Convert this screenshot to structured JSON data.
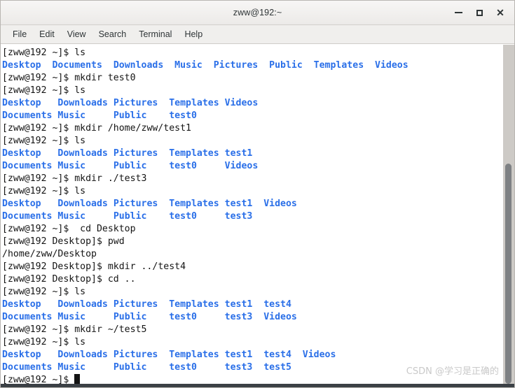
{
  "window": {
    "title": "zww@192:~",
    "buttons": {
      "minimize": "minimize",
      "maximize": "maximize",
      "close": "✕"
    }
  },
  "menubar": {
    "items": [
      {
        "label": "File"
      },
      {
        "label": "Edit"
      },
      {
        "label": "View"
      },
      {
        "label": "Search"
      },
      {
        "label": "Terminal"
      },
      {
        "label": "Help"
      }
    ]
  },
  "terminal": {
    "prompt_home": "[zww@192 ~]$ ",
    "prompt_desktop": "[zww@192 Desktop]$ ",
    "cursor": "block",
    "lines": [
      {
        "type": "command",
        "prompt": "[zww@192 ~]$ ",
        "command": "ls"
      },
      {
        "type": "listing",
        "cells": [
          "Desktop",
          "Documents",
          "Downloads",
          "Music",
          "Pictures",
          "Public",
          "Templates",
          "Videos"
        ],
        "layout": "inline"
      },
      {
        "type": "command",
        "prompt": "[zww@192 ~]$ ",
        "command": "mkdir test0"
      },
      {
        "type": "command",
        "prompt": "[zww@192 ~]$ ",
        "command": "ls"
      },
      {
        "type": "listing",
        "cells": [
          "Desktop",
          "Downloads",
          "Pictures",
          "Templates",
          "Videos"
        ],
        "layout": "columns"
      },
      {
        "type": "listing",
        "cells": [
          "Documents",
          "Music",
          "Public",
          "test0"
        ],
        "layout": "columns"
      },
      {
        "type": "command",
        "prompt": "[zww@192 ~]$ ",
        "command": "mkdir /home/zww/test1"
      },
      {
        "type": "command",
        "prompt": "[zww@192 ~]$ ",
        "command": "ls"
      },
      {
        "type": "listing",
        "cells": [
          "Desktop",
          "Downloads",
          "Pictures",
          "Templates",
          "test1"
        ],
        "layout": "columns"
      },
      {
        "type": "listing",
        "cells": [
          "Documents",
          "Music",
          "Public",
          "test0",
          "Videos"
        ],
        "layout": "columns"
      },
      {
        "type": "command",
        "prompt": "[zww@192 ~]$ ",
        "command": "mkdir ./test3"
      },
      {
        "type": "command",
        "prompt": "[zww@192 ~]$ ",
        "command": "ls"
      },
      {
        "type": "listing",
        "cells": [
          "Desktop",
          "Downloads",
          "Pictures",
          "Templates",
          "test1",
          "Videos"
        ],
        "layout": "columns6"
      },
      {
        "type": "listing",
        "cells": [
          "Documents",
          "Music",
          "Public",
          "test0",
          "test3"
        ],
        "layout": "columns6"
      },
      {
        "type": "command",
        "prompt": "[zww@192 ~]$ ",
        "command": " cd Desktop"
      },
      {
        "type": "command",
        "prompt": "[zww@192 Desktop]$ ",
        "command": "pwd"
      },
      {
        "type": "output",
        "text": "/home/zww/Desktop"
      },
      {
        "type": "command",
        "prompt": "[zww@192 Desktop]$ ",
        "command": "mkdir ../test4"
      },
      {
        "type": "command",
        "prompt": "[zww@192 Desktop]$ ",
        "command": "cd .."
      },
      {
        "type": "command",
        "prompt": "[zww@192 ~]$ ",
        "command": "ls"
      },
      {
        "type": "listing",
        "cells": [
          "Desktop",
          "Downloads",
          "Pictures",
          "Templates",
          "test1",
          "test4"
        ],
        "layout": "columns6"
      },
      {
        "type": "listing",
        "cells": [
          "Documents",
          "Music",
          "Public",
          "test0",
          "test3",
          "Videos"
        ],
        "layout": "columns6"
      },
      {
        "type": "command",
        "prompt": "[zww@192 ~]$ ",
        "command": "mkdir ~/test5"
      },
      {
        "type": "command",
        "prompt": "[zww@192 ~]$ ",
        "command": "ls"
      },
      {
        "type": "listing",
        "cells": [
          "Desktop",
          "Downloads",
          "Pictures",
          "Templates",
          "test1",
          "test4",
          "Videos"
        ],
        "layout": "columns7"
      },
      {
        "type": "listing",
        "cells": [
          "Documents",
          "Music",
          "Public",
          "test0",
          "test3",
          "test5"
        ],
        "layout": "columns7"
      },
      {
        "type": "prompt_cursor",
        "prompt": "[zww@192 ~]$ "
      }
    ]
  },
  "scrollbar": {
    "thumb_top_percent": 35,
    "thumb_height_percent": 65
  },
  "watermark": {
    "text": "CSDN @学习是正确的"
  },
  "colors": {
    "directory": "#2a6fe8",
    "text": "#141414",
    "titlebar": "#f0efed",
    "terminal_bg": "#ffffff"
  }
}
